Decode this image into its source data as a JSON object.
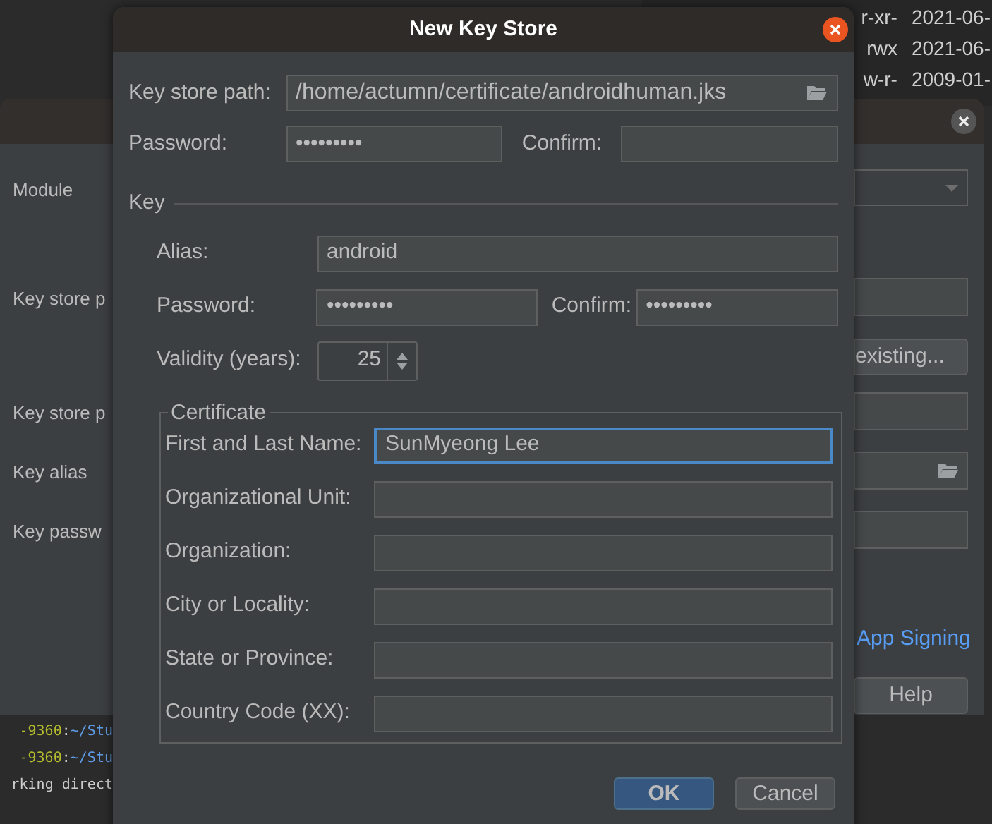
{
  "file_listing": [
    {
      "perms": "r-xr-",
      "date": "2021-06-"
    },
    {
      "perms": "rwx",
      "date": "2021-06-"
    },
    {
      "perms": "w-r-",
      "date": "2009-01-"
    }
  ],
  "terminal": {
    "lines": [
      {
        "host": "-9360",
        "sep": ":",
        "path": "~/Stu"
      },
      {
        "host": "-9360",
        "sep": ":",
        "path": "~/Stu"
      },
      {
        "text": "rking direct"
      }
    ]
  },
  "back_dialog": {
    "labels": [
      "Module",
      "Key store p",
      "Key store p",
      "Key alias",
      "Key passw"
    ],
    "existing_button": "existing...",
    "link": "App Signing",
    "help_button": "Help"
  },
  "dialog": {
    "title": "New Key Store",
    "key_store_path": {
      "label": "Key store path:",
      "value": "/home/actumn/certificate/androidhuman.jks"
    },
    "password": {
      "label": "Password:",
      "value": "•••••••••"
    },
    "confirm": {
      "label": "Confirm:"
    },
    "key": {
      "title": "Key",
      "alias": {
        "label": "Alias:",
        "value": "android"
      },
      "password": {
        "label": "Password:",
        "value": "•••••••••"
      },
      "confirm": {
        "label": "Confirm:",
        "value": "•••••••••"
      },
      "validity": {
        "label": "Validity (years):",
        "value": "25"
      },
      "certificate": {
        "title": "Certificate",
        "fields": [
          {
            "label": "First and Last Name:",
            "value": "SunMyeong Lee",
            "focused": true
          },
          {
            "label": "Organizational Unit:",
            "focused": false
          },
          {
            "label": "Organization:",
            "focused": false
          },
          {
            "label": "City or Locality:",
            "focused": false
          },
          {
            "label": "State or Province:",
            "focused": false
          },
          {
            "label": "Country Code (XX):",
            "focused": false
          }
        ]
      }
    },
    "buttons": [
      {
        "label": "OK",
        "primary": true
      },
      {
        "label": "Cancel",
        "primary": false
      }
    ]
  }
}
